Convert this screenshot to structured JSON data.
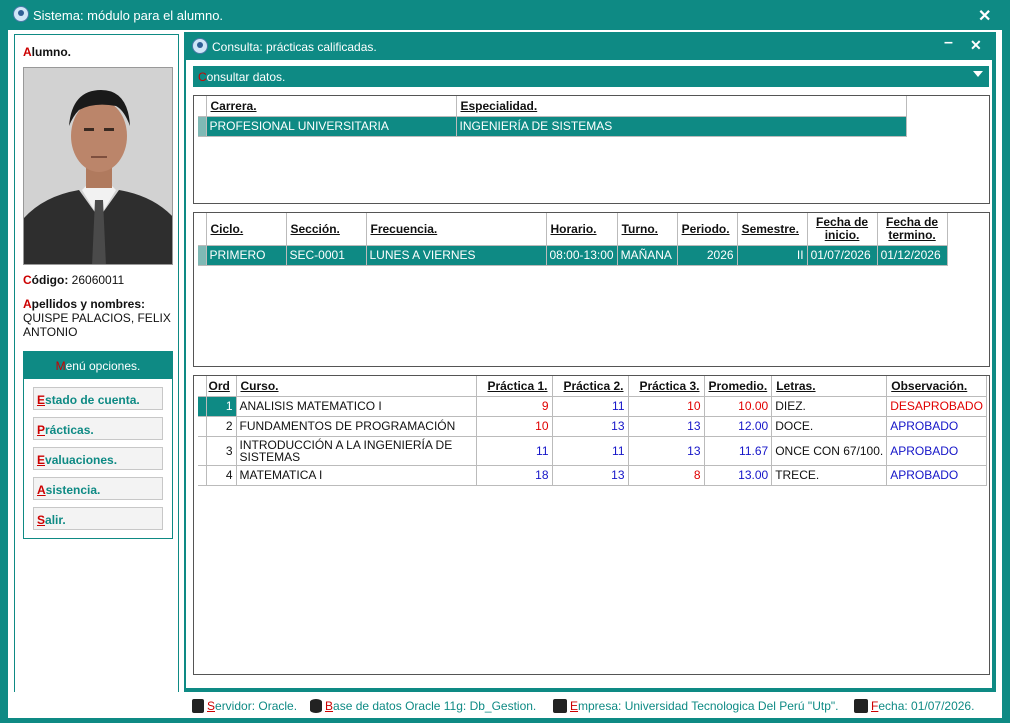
{
  "outer": {
    "title": "Sistema: módulo para el alumno."
  },
  "student": {
    "section_label_hk": "A",
    "section_label_rest": "lumno.",
    "code_label_hk": "C",
    "code_label_rest": "ódigo:",
    "code_value": "26060011",
    "names_label_hk": "A",
    "names_label_rest": "pellidos y nombres:",
    "names_value": "QUISPE PALACIOS, FELIX ANTONIO"
  },
  "menu": {
    "title_hk": "M",
    "title_rest": "enú opciones.",
    "items": [
      {
        "hk": "E",
        "rest": "stado de cuenta."
      },
      {
        "hk": "P",
        "rest": "rácticas."
      },
      {
        "hk": "E",
        "rest": "valuaciones."
      },
      {
        "hk": "A",
        "rest": "sistencia."
      },
      {
        "hk": "S",
        "rest": "alir."
      }
    ]
  },
  "inner": {
    "title": "Consulta: prácticas calificadas.",
    "consult_hk": "C",
    "consult_rest": "onsultar datos."
  },
  "career_table": {
    "headers": [
      "Carrera.",
      "Especialidad."
    ],
    "row": [
      "PROFESIONAL UNIVERSITARIA",
      "INGENIERÍA DE SISTEMAS"
    ]
  },
  "cycle_table": {
    "headers": [
      "Ciclo.",
      "Sección.",
      "Frecuencia.",
      "Horario.",
      "Turno.",
      "Periodo.",
      "Semestre.",
      "Fecha de inicio.",
      "Fecha de termino."
    ],
    "row": [
      "PRIMERO",
      "SEC-0001",
      "LUNES A VIERNES",
      "08:00-13:00",
      "MAÑANA",
      "2026",
      "II",
      "01/07/2026",
      "01/12/2026"
    ]
  },
  "grades_table": {
    "headers": [
      "Ord",
      "Curso.",
      "Práctica 1.",
      "Práctica 2.",
      "Práctica 3.",
      "Promedio.",
      "Letras.",
      "Observación."
    ],
    "rows": [
      [
        "1",
        "ANALISIS MATEMATICO I",
        "9",
        "11",
        "10",
        "10.00",
        "DIEZ.",
        "DESAPROBADO"
      ],
      [
        "2",
        "FUNDAMENTOS DE PROGRAMACIÓN",
        "10",
        "13",
        "13",
        "12.00",
        "DOCE.",
        "APROBADO"
      ],
      [
        "3",
        "INTRODUCCIÓN A LA INGENIERÍA DE SISTEMAS",
        "11",
        "11",
        "13",
        "11.67",
        "ONCE CON 67/100.",
        "APROBADO"
      ],
      [
        "4",
        "MATEMATICA I",
        "18",
        "13",
        "8",
        "13.00",
        "TRECE.",
        "APROBADO"
      ]
    ]
  },
  "status": {
    "server_hk": "S",
    "server_rest": "ervidor:",
    "server_value": "Oracle.",
    "db_hk": "B",
    "db_rest": "ase de datos Oracle 11g:",
    "db_value": "Db_Gestion.",
    "company_hk": "E",
    "company_rest": "mpresa:",
    "company_value": "Universidad Tecnologica Del Perú \"Utp\".",
    "date_hk": "F",
    "date_rest": "echa:",
    "date_value": "01/07/2026."
  },
  "colors": {
    "accent": "#0e8a84",
    "fail": "#e00000",
    "pass": "#1515c8",
    "hotkey": "#cc0000"
  }
}
